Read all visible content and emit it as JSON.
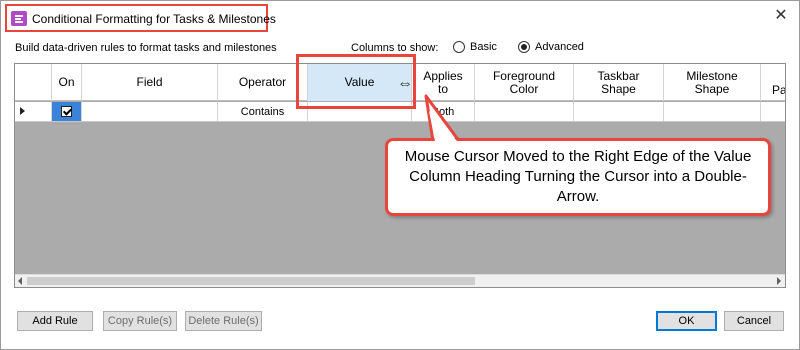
{
  "window": {
    "title": "Conditional Formatting for Tasks & Milestones",
    "icon": "conditional-formatting-icon",
    "close_glyph": "✕"
  },
  "instructions": "Build data-driven rules to format tasks and milestones",
  "columns_to_show": {
    "label": "Columns to show:",
    "options": [
      {
        "label": "Basic",
        "selected": false
      },
      {
        "label": "Advanced",
        "selected": true
      }
    ]
  },
  "grid": {
    "columns": [
      "On",
      "Field",
      "Operator",
      "Value",
      "Applies to",
      "Foreground Color",
      "Taskbar Shape",
      "Milestone Shape",
      "Pa"
    ],
    "header_lines": {
      "applies": "Applies",
      "to": "to",
      "foreground": "Foreground",
      "color": "Color",
      "taskbar": "Taskbar",
      "taskbar_shape": "Shape",
      "milestone": "Milestone",
      "milestone_shape": "Shape"
    },
    "rows": [
      {
        "on": true,
        "field": "",
        "operator": "Contains",
        "value": "",
        "applies_to": "Both"
      }
    ]
  },
  "annotation": {
    "callout_text": "Mouse Cursor Moved to the Right Edge of the Value Column Heading Turning the Cursor into a Double-Arrow.",
    "cursor": "⇔",
    "accent_color": "#e8453c"
  },
  "buttons": {
    "add_rule": "Add Rule",
    "copy_rules": "Copy Rule(s)",
    "delete_rules": "Delete Rule(s)",
    "ok": "OK",
    "cancel": "Cancel"
  },
  "colors": {
    "grid_background": "#ababab",
    "value_header_highlight": "#d4e8f8",
    "selected_cell": "#3b82d9",
    "accent": "#e8453c"
  }
}
